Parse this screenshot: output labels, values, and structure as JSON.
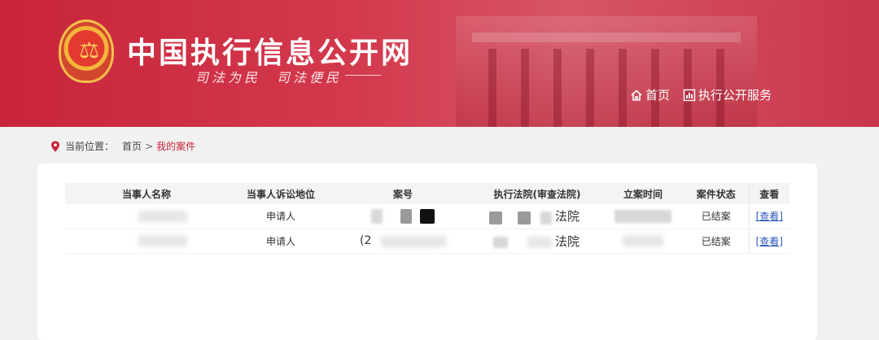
{
  "site": {
    "title": "中国执行信息公开网",
    "slogan": "司法为民　司法便民"
  },
  "nav": {
    "items": [
      {
        "label": "首页",
        "icon": "home-icon"
      },
      {
        "label": "执行公开服务",
        "icon": "chart-icon"
      }
    ]
  },
  "breadcrumb": {
    "prefix": "当前位置：",
    "home": "首页",
    "separator": ">",
    "current": "我的案件"
  },
  "table": {
    "headers": [
      "当事人名称",
      "当事人诉讼地位",
      "案号",
      "执行法院(审查法院)",
      "立案时间",
      "案件状态",
      "查看"
    ],
    "rows": [
      {
        "party": "",
        "role": "申请人",
        "case_no": "",
        "court_suffix": "法院",
        "date": "",
        "status": "已结案",
        "view": "[查看]"
      },
      {
        "party": "",
        "role": "申请人",
        "case_no": "(2",
        "court_suffix": "法院",
        "date": "",
        "status": "已结案",
        "view": "[查看]"
      }
    ]
  },
  "colors": {
    "brand_red": "#c8243a",
    "link_blue": "#2a57b8"
  }
}
